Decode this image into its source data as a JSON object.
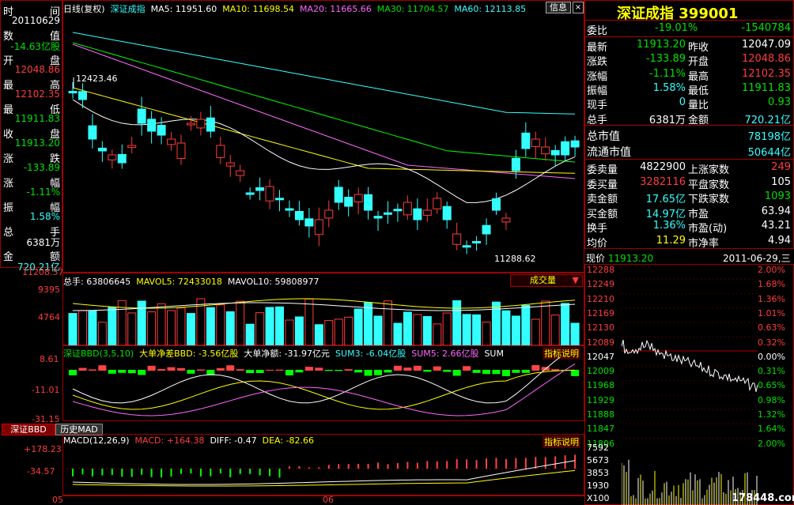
{
  "left_panel": {
    "items": [
      {
        "k1": "时",
        "k2": "间",
        "v": "20110629",
        "vc": "wht"
      },
      {
        "k1": "数",
        "k2": "值",
        "v": "-14.63亿股",
        "vc": "grn"
      },
      {
        "k1": "开",
        "k2": "盘",
        "v": "12048.86",
        "vc": "red"
      },
      {
        "k1": "最",
        "k2": "高",
        "v": "12102.35",
        "vc": "red"
      },
      {
        "k1": "最",
        "k2": "低",
        "v": "11911.83",
        "vc": "grn"
      },
      {
        "k1": "收",
        "k2": "盘",
        "v": "11913.20",
        "vc": "grn"
      },
      {
        "k1": "涨",
        "k2": "跌",
        "v": "-133.89",
        "vc": "grn"
      },
      {
        "k1": "涨",
        "k2": "幅",
        "v": "-1.11%",
        "vc": "grn"
      },
      {
        "k1": "振",
        "k2": "幅",
        "v": "1.58%",
        "vc": "cyn"
      },
      {
        "k1": "总",
        "k2": "手",
        "v": "6381万",
        "vc": "wht"
      },
      {
        "k1": "金",
        "k2": "额",
        "v": "720.21亿",
        "vc": "cyn"
      }
    ]
  },
  "axis": {
    "price_labels": [
      "11208.57"
    ],
    "vol_labels": [
      "9395",
      "4764"
    ],
    "bbd_labels": [
      "8.61",
      "-11.01",
      "-31.15"
    ],
    "macd_labels": [
      "+178.23",
      "-34.57"
    ],
    "month_labels": [
      "05",
      "06"
    ]
  },
  "kline_header": {
    "period": "日线(复权)",
    "name": "深证成指",
    "ma5": "MA5: 11951.60",
    "ma10": "MA10: 11698.54",
    "ma20": "MA20: 11665.66",
    "ma30": "MA30: 11704.57",
    "ma60": "MA60: 12113.85",
    "info_btn": "信息",
    "high_mark": "12423.46",
    "low_mark": "11288.62"
  },
  "volume_header": {
    "total": "总手: 63806645",
    "mavol5": "MAVOL5: 72433018",
    "mavol10": "MAVOL10: 59808977",
    "dropdown": "成交量"
  },
  "bbd_header": {
    "title": "深证BBD(3,5,10)",
    "net_bbd": "大单净差BBD: -3.56亿股",
    "net_amount": "大单净额: -31.97亿元",
    "sum3": "SUM3: -6.04亿股",
    "sum5": "SUM5: 2.66亿股",
    "sum_more": "SUM",
    "explain": "指标说明"
  },
  "tabs": [
    "深证BBD",
    "历史MAD"
  ],
  "macd_header": {
    "title": "MACD(12,26,9)",
    "macd": "MACD: +164.38",
    "diff": "DIFF: -0.47",
    "dea": "DEA: -82.66",
    "explain": "指标说明"
  },
  "quote": {
    "title": "深证成指 399001",
    "weibi": {
      "label": "委比",
      "v1": "-19.01%",
      "v2": "-1540784"
    },
    "rows": [
      {
        "l1": "最新",
        "v1": "11913.20",
        "c1": "grn",
        "l2": "昨收",
        "v2": "12047.09",
        "c2": "wht"
      },
      {
        "l1": "涨跌",
        "v1": "-133.89",
        "c1": "grn",
        "l2": "开盘",
        "v2": "12048.86",
        "c2": "red"
      },
      {
        "l1": "涨幅",
        "v1": "-1.11%",
        "c1": "grn",
        "l2": "最高",
        "v2": "12102.35",
        "c2": "red"
      },
      {
        "l1": "振幅",
        "v1": "1.58%",
        "c1": "cyn",
        "l2": "最低",
        "v2": "11911.83",
        "c2": "grn"
      },
      {
        "l1": "现手",
        "v1": "0",
        "c1": "cyn",
        "l2": "量比",
        "v2": "0.93",
        "c2": "grn"
      },
      {
        "l1": "总手",
        "v1": "6381万",
        "c1": "wht",
        "l2": "金额",
        "v2": "720.21亿",
        "c2": "cyn"
      }
    ],
    "mcap": [
      {
        "l": "总市值",
        "v": "78198亿"
      },
      {
        "l": "流通市值",
        "v": "50644亿"
      }
    ],
    "bottom": [
      {
        "l1": "委卖量",
        "v1": "4822900",
        "c1": "wht",
        "l2": "上涨家数",
        "v2": "249",
        "c2": "red"
      },
      {
        "l1": "委买量",
        "v1": "3282116",
        "c1": "red",
        "l2": "平盘家数",
        "v2": "105",
        "c2": "wht"
      },
      {
        "l1": "卖金额",
        "v1": "17.65亿",
        "c1": "cyn",
        "l2": "下跌家数",
        "v2": "1093",
        "c2": "grn"
      },
      {
        "l1": "买金额",
        "v1": "14.97亿",
        "c1": "cyn",
        "l2": "市盈",
        "v2": "63.94",
        "c2": "wht"
      },
      {
        "l1": "换手",
        "v1": "1.36%",
        "c1": "cyn",
        "l2": "市盈(动)",
        "v2": "43.21",
        "c2": "wht"
      },
      {
        "l1": "均价",
        "v1": "11.29",
        "c1": "yel",
        "l2": "市净率",
        "v2": "4.94",
        "c2": "wht"
      }
    ]
  },
  "intraday": {
    "price_label": "现价",
    "price_value": "11913.20",
    "date": "2011-06-29",
    "weekday": "三",
    "left_labels": [
      "12288",
      "12249",
      "12210",
      "12169",
      "12130",
      "12089",
      "12047",
      "12009",
      "11968",
      "11929",
      "11888",
      "11847",
      "11806"
    ],
    "right_labels": [
      "2.00%",
      "1.68%",
      "1.36%",
      "1.01%",
      "0.63%",
      "0.32%",
      "0.00%",
      "0.31%",
      "0.65%",
      "0.98%",
      "1.32%",
      "1.64%",
      "2.00%"
    ],
    "vol_labels": [
      "7592",
      "5673",
      "3853",
      "1930",
      "X100"
    ],
    "watermark": "178448.com"
  },
  "chart_data": {
    "type": "candlestick",
    "title": "深证成指 日线(复权)",
    "ohlc_hint": "daily candles May–Jun 2011, high 12423.46, low 11288.62"
  }
}
